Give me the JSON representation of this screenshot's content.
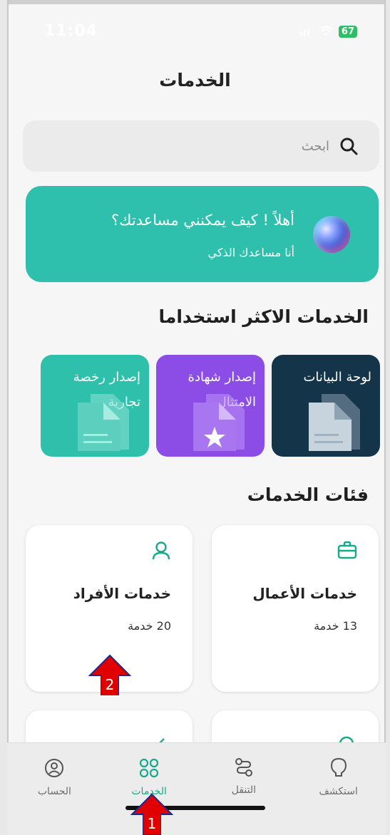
{
  "status_bar": {
    "time": "11:04",
    "battery": "67"
  },
  "page": {
    "title": "الخدمات"
  },
  "search": {
    "placeholder": "ابحث",
    "icon": "search-icon"
  },
  "assistant": {
    "title": "أهلاً ! كيف يمكنني مساعدتك؟",
    "subtitle": "أنا مساعدك الذكي"
  },
  "popular": {
    "heading": "الخدمات الاكثر استخداما",
    "tiles": [
      {
        "label": "لوحة البيانات",
        "color": "#14344a"
      },
      {
        "label": "إصدار شهادة الامتثال",
        "color": "#8c4de6"
      },
      {
        "label": "إصدار رخصة تجارية",
        "color": "#2fc0ab"
      }
    ]
  },
  "categories": {
    "heading": "فئات الخدمات",
    "items": [
      {
        "name": "خدمات الأعمال",
        "count": "13 خدمة",
        "icon": "briefcase-icon"
      },
      {
        "name": "خدمات الأفراد",
        "count": "20 خدمة",
        "icon": "user-icon"
      }
    ]
  },
  "tabs": [
    {
      "label": "استكشف",
      "icon": "lightbulb-icon",
      "active": false
    },
    {
      "label": "التنقل",
      "icon": "route-icon",
      "active": false
    },
    {
      "label": "الخدمات",
      "icon": "grid-circles-icon",
      "active": true
    },
    {
      "label": "الحساب",
      "icon": "account-icon",
      "active": false
    }
  ],
  "annotations": [
    "1",
    "2"
  ],
  "colors": {
    "accent": "#2ec0ad",
    "active_tab": "#17a98c",
    "annotation": "#e00000"
  }
}
